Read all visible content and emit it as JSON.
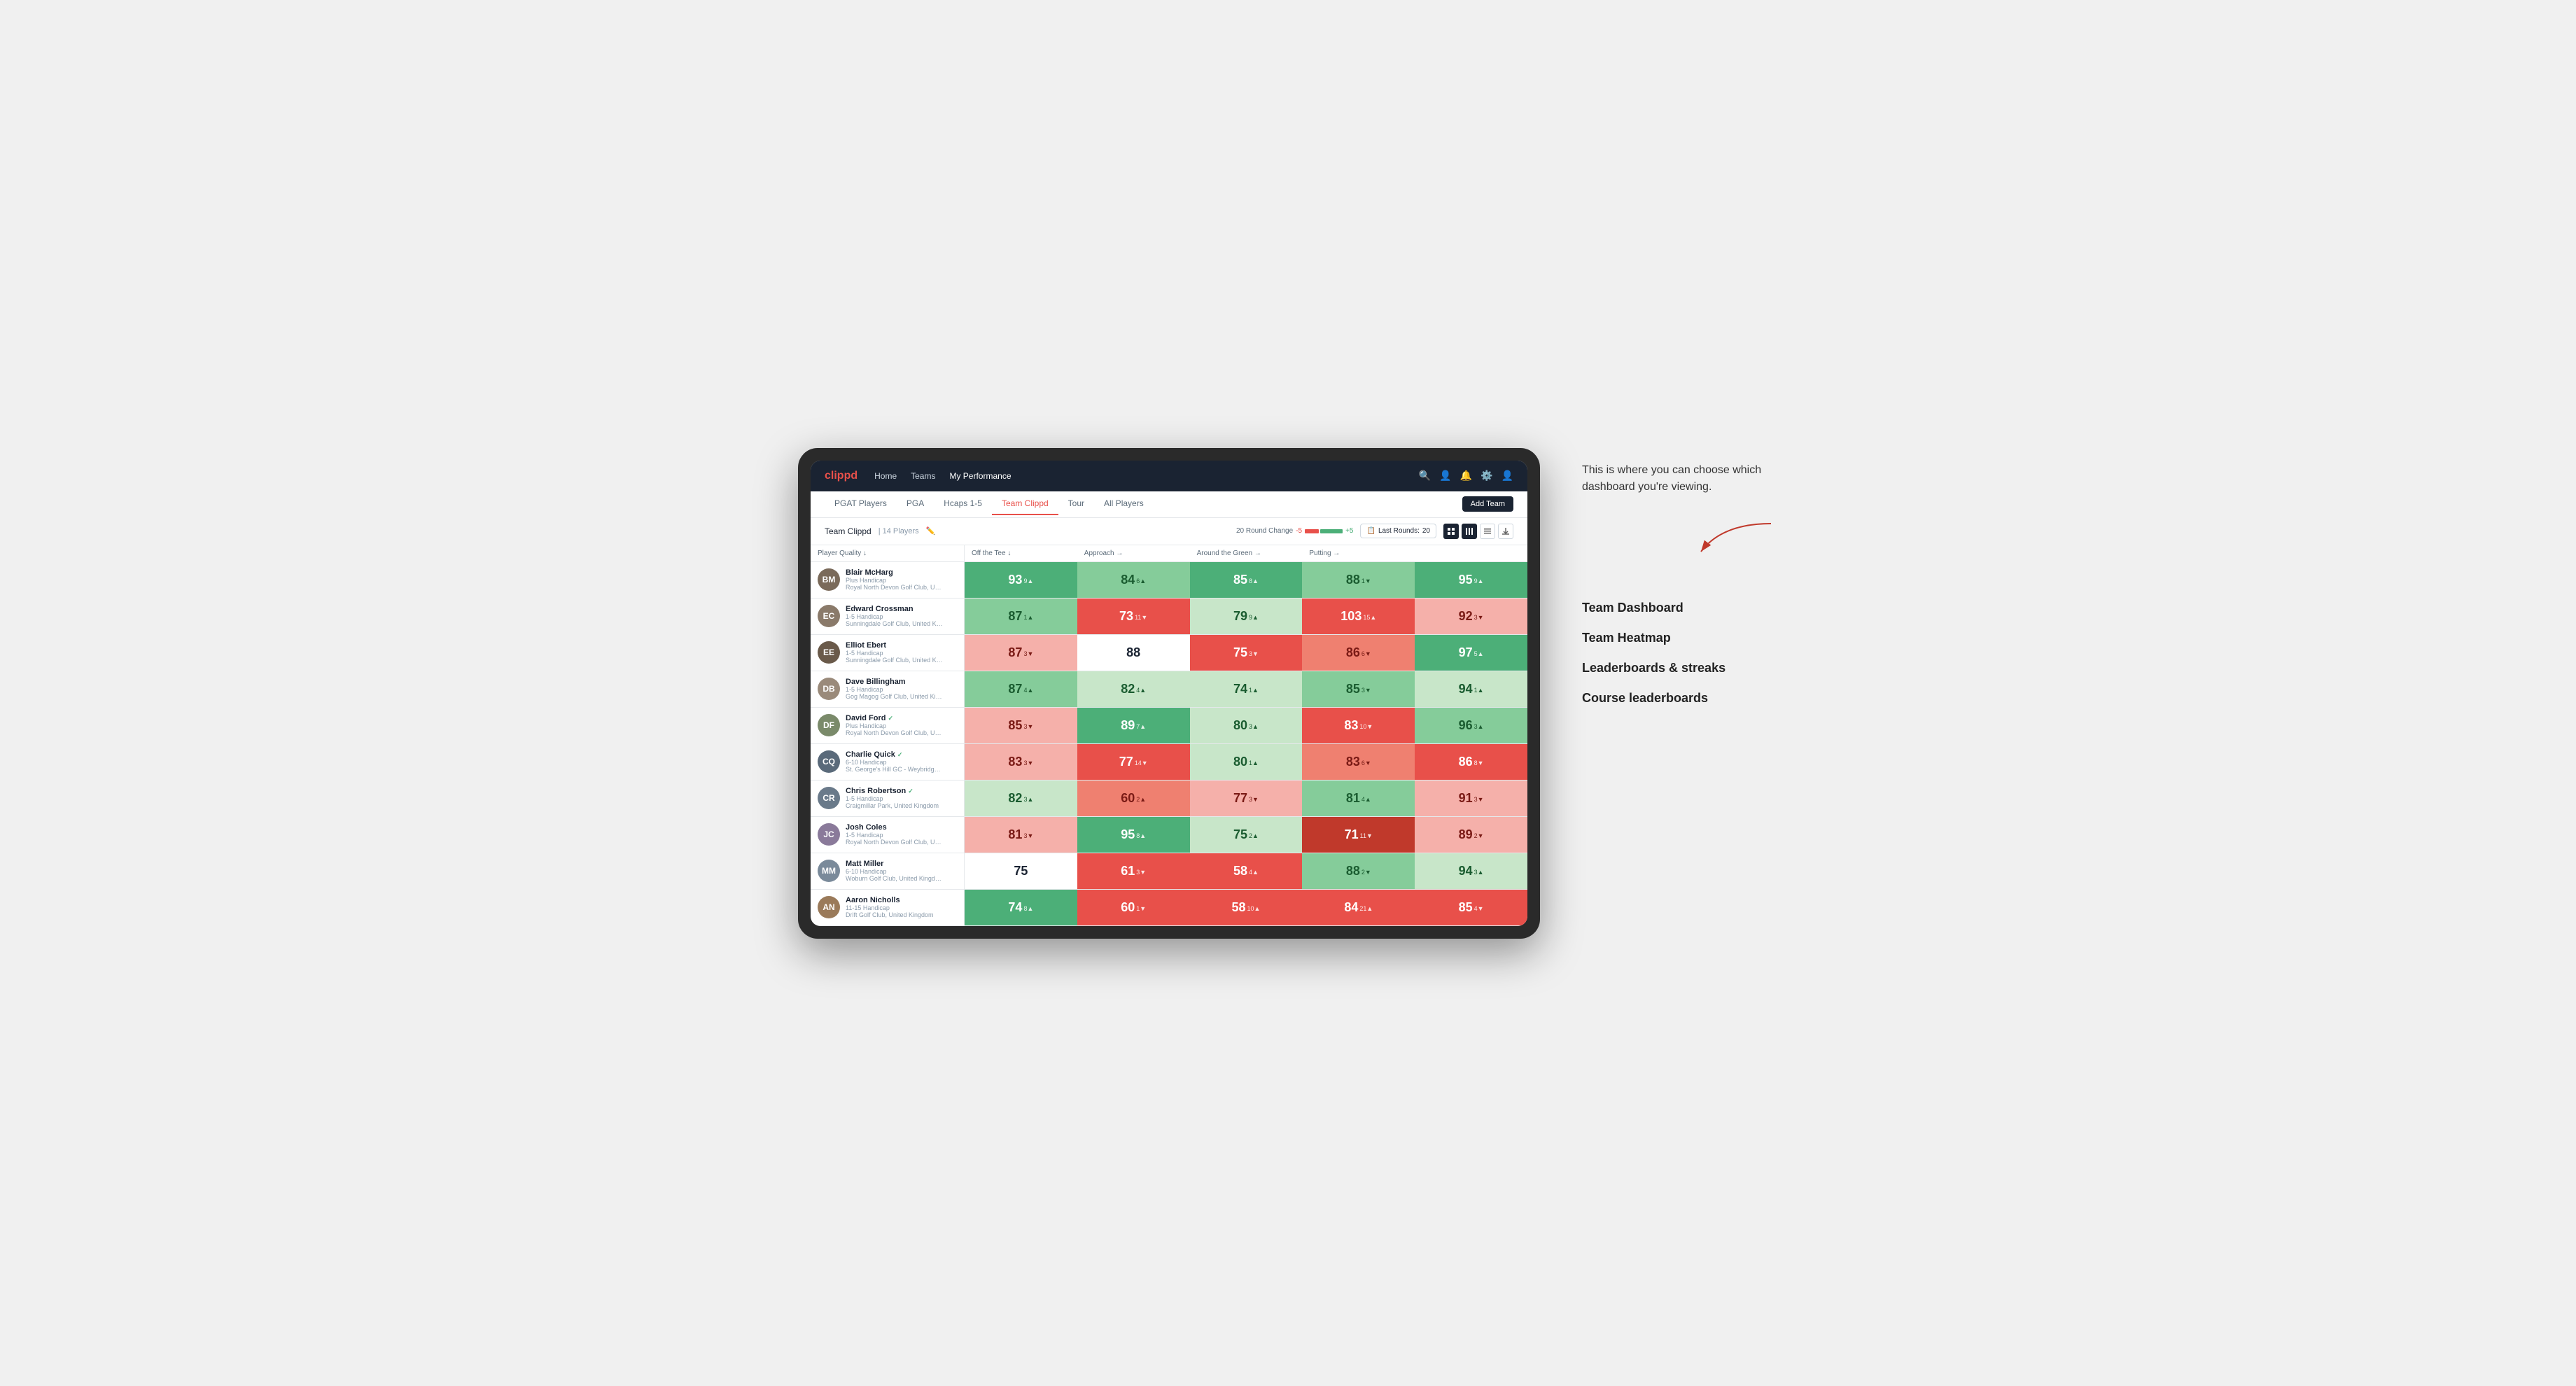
{
  "annotation": {
    "intro": "This is where you can choose which dashboard you're viewing.",
    "items": [
      "Team Dashboard",
      "Team Heatmap",
      "Leaderboards & streaks",
      "Course leaderboards"
    ]
  },
  "nav": {
    "logo": "clippd",
    "links": [
      "Home",
      "Teams",
      "My Performance"
    ],
    "active_link": "My Performance"
  },
  "sub_nav": {
    "tabs": [
      "PGAT Players",
      "PGA",
      "Hcaps 1-5",
      "Team Clippd",
      "Tour",
      "All Players"
    ],
    "active_tab": "Team Clippd",
    "add_team_label": "Add Team"
  },
  "team_header": {
    "name": "Team Clippd",
    "separator": "|",
    "count": "14 Players",
    "round_change_label": "20 Round Change",
    "minus": "-5",
    "plus": "+5",
    "last_rounds_label": "Last Rounds:",
    "last_rounds_value": "20"
  },
  "table": {
    "columns": [
      "Player Quality ↓",
      "Off the Tee ↓",
      "Approach →",
      "Around the Green →",
      "Putting →"
    ],
    "rows": [
      {
        "name": "Blair McHarg",
        "handicap": "Plus Handicap",
        "club": "Royal North Devon Golf Club, United Kingdom",
        "avatar_initials": "BM",
        "avatar_color": "#7a6a5a",
        "stats": [
          {
            "value": "93",
            "change": "9▲",
            "bg": "bg-green-mid"
          },
          {
            "value": "84",
            "change": "6▲",
            "bg": "bg-green-light"
          },
          {
            "value": "85",
            "change": "8▲",
            "bg": "bg-green-mid"
          },
          {
            "value": "88",
            "change": "1▼",
            "bg": "bg-green-light"
          },
          {
            "value": "95",
            "change": "9▲",
            "bg": "bg-green-mid"
          }
        ]
      },
      {
        "name": "Edward Crossman",
        "handicap": "1-5 Handicap",
        "club": "Sunningdale Golf Club, United Kingdom",
        "avatar_initials": "EC",
        "avatar_color": "#8a7a6a",
        "stats": [
          {
            "value": "87",
            "change": "1▲",
            "bg": "bg-green-light"
          },
          {
            "value": "73",
            "change": "11▼",
            "bg": "bg-red-mid"
          },
          {
            "value": "79",
            "change": "9▲",
            "bg": "bg-green-pale"
          },
          {
            "value": "103",
            "change": "15▲",
            "bg": "bg-red-mid"
          },
          {
            "value": "92",
            "change": "3▼",
            "bg": "bg-red-pale"
          }
        ]
      },
      {
        "name": "Elliot Ebert",
        "handicap": "1-5 Handicap",
        "club": "Sunningdale Golf Club, United Kingdom",
        "avatar_initials": "EE",
        "avatar_color": "#6a5a4a",
        "stats": [
          {
            "value": "87",
            "change": "3▼",
            "bg": "bg-red-pale"
          },
          {
            "value": "88",
            "change": "",
            "bg": "bg-white"
          },
          {
            "value": "75",
            "change": "3▼",
            "bg": "bg-red-mid"
          },
          {
            "value": "86",
            "change": "6▼",
            "bg": "bg-red-light"
          },
          {
            "value": "97",
            "change": "5▲",
            "bg": "bg-green-mid"
          }
        ]
      },
      {
        "name": "Dave Billingham",
        "handicap": "1-5 Handicap",
        "club": "Gog Magog Golf Club, United Kingdom",
        "avatar_initials": "DB",
        "avatar_color": "#9a8a7a",
        "stats": [
          {
            "value": "87",
            "change": "4▲",
            "bg": "bg-green-light"
          },
          {
            "value": "82",
            "change": "4▲",
            "bg": "bg-green-pale"
          },
          {
            "value": "74",
            "change": "1▲",
            "bg": "bg-green-pale"
          },
          {
            "value": "85",
            "change": "3▼",
            "bg": "bg-green-light"
          },
          {
            "value": "94",
            "change": "1▲",
            "bg": "bg-green-pale"
          }
        ]
      },
      {
        "name": "David Ford",
        "handicap": "Plus Handicap",
        "club": "Royal North Devon Golf Club, United Kingdom",
        "avatar_initials": "DF",
        "avatar_color": "#7a8a6a",
        "verified": true,
        "stats": [
          {
            "value": "85",
            "change": "3▼",
            "bg": "bg-red-pale"
          },
          {
            "value": "89",
            "change": "7▲",
            "bg": "bg-green-mid"
          },
          {
            "value": "80",
            "change": "3▲",
            "bg": "bg-green-pale"
          },
          {
            "value": "83",
            "change": "10▼",
            "bg": "bg-red-mid"
          },
          {
            "value": "96",
            "change": "3▲",
            "bg": "bg-green-light"
          }
        ]
      },
      {
        "name": "Charlie Quick",
        "handicap": "6-10 Handicap",
        "club": "St. George's Hill GC - Weybridge - Surrey, Uni...",
        "avatar_initials": "CQ",
        "avatar_color": "#5a6a7a",
        "verified": true,
        "stats": [
          {
            "value": "83",
            "change": "3▼",
            "bg": "bg-red-pale"
          },
          {
            "value": "77",
            "change": "14▼",
            "bg": "bg-red-mid"
          },
          {
            "value": "80",
            "change": "1▲",
            "bg": "bg-green-pale"
          },
          {
            "value": "83",
            "change": "6▼",
            "bg": "bg-red-light"
          },
          {
            "value": "86",
            "change": "8▼",
            "bg": "bg-red-mid"
          }
        ]
      },
      {
        "name": "Chris Robertson",
        "handicap": "1-5 Handicap",
        "club": "Craigmillar Park, United Kingdom",
        "avatar_initials": "CR",
        "avatar_color": "#6a7a8a",
        "verified": true,
        "stats": [
          {
            "value": "82",
            "change": "3▲",
            "bg": "bg-green-pale"
          },
          {
            "value": "60",
            "change": "2▲",
            "bg": "bg-red-light"
          },
          {
            "value": "77",
            "change": "3▼",
            "bg": "bg-red-pale"
          },
          {
            "value": "81",
            "change": "4▲",
            "bg": "bg-green-light"
          },
          {
            "value": "91",
            "change": "3▼",
            "bg": "bg-red-pale"
          }
        ]
      },
      {
        "name": "Josh Coles",
        "handicap": "1-5 Handicap",
        "club": "Royal North Devon Golf Club, United Kingdom",
        "avatar_initials": "JC",
        "avatar_color": "#8a7a9a",
        "stats": [
          {
            "value": "81",
            "change": "3▼",
            "bg": "bg-red-pale"
          },
          {
            "value": "95",
            "change": "8▲",
            "bg": "bg-green-mid"
          },
          {
            "value": "75",
            "change": "2▲",
            "bg": "bg-green-pale"
          },
          {
            "value": "71",
            "change": "11▼",
            "bg": "bg-red-strong"
          },
          {
            "value": "89",
            "change": "2▼",
            "bg": "bg-red-pale"
          }
        ]
      },
      {
        "name": "Matt Miller",
        "handicap": "6-10 Handicap",
        "club": "Woburn Golf Club, United Kingdom",
        "avatar_initials": "MM",
        "avatar_color": "#7a8a9a",
        "stats": [
          {
            "value": "75",
            "change": "",
            "bg": "bg-white"
          },
          {
            "value": "61",
            "change": "3▼",
            "bg": "bg-red-mid"
          },
          {
            "value": "58",
            "change": "4▲",
            "bg": "bg-red-mid"
          },
          {
            "value": "88",
            "change": "2▼",
            "bg": "bg-green-light"
          },
          {
            "value": "94",
            "change": "3▲",
            "bg": "bg-green-pale"
          }
        ]
      },
      {
        "name": "Aaron Nicholls",
        "handicap": "11-15 Handicap",
        "club": "Drift Golf Club, United Kingdom",
        "avatar_initials": "AN",
        "avatar_color": "#9a7a5a",
        "stats": [
          {
            "value": "74",
            "change": "8▲",
            "bg": "bg-green-mid"
          },
          {
            "value": "60",
            "change": "1▼",
            "bg": "bg-red-mid"
          },
          {
            "value": "58",
            "change": "10▲",
            "bg": "bg-red-mid"
          },
          {
            "value": "84",
            "change": "21▲",
            "bg": "bg-red-mid"
          },
          {
            "value": "85",
            "change": "4▼",
            "bg": "bg-red-mid"
          }
        ]
      }
    ]
  }
}
